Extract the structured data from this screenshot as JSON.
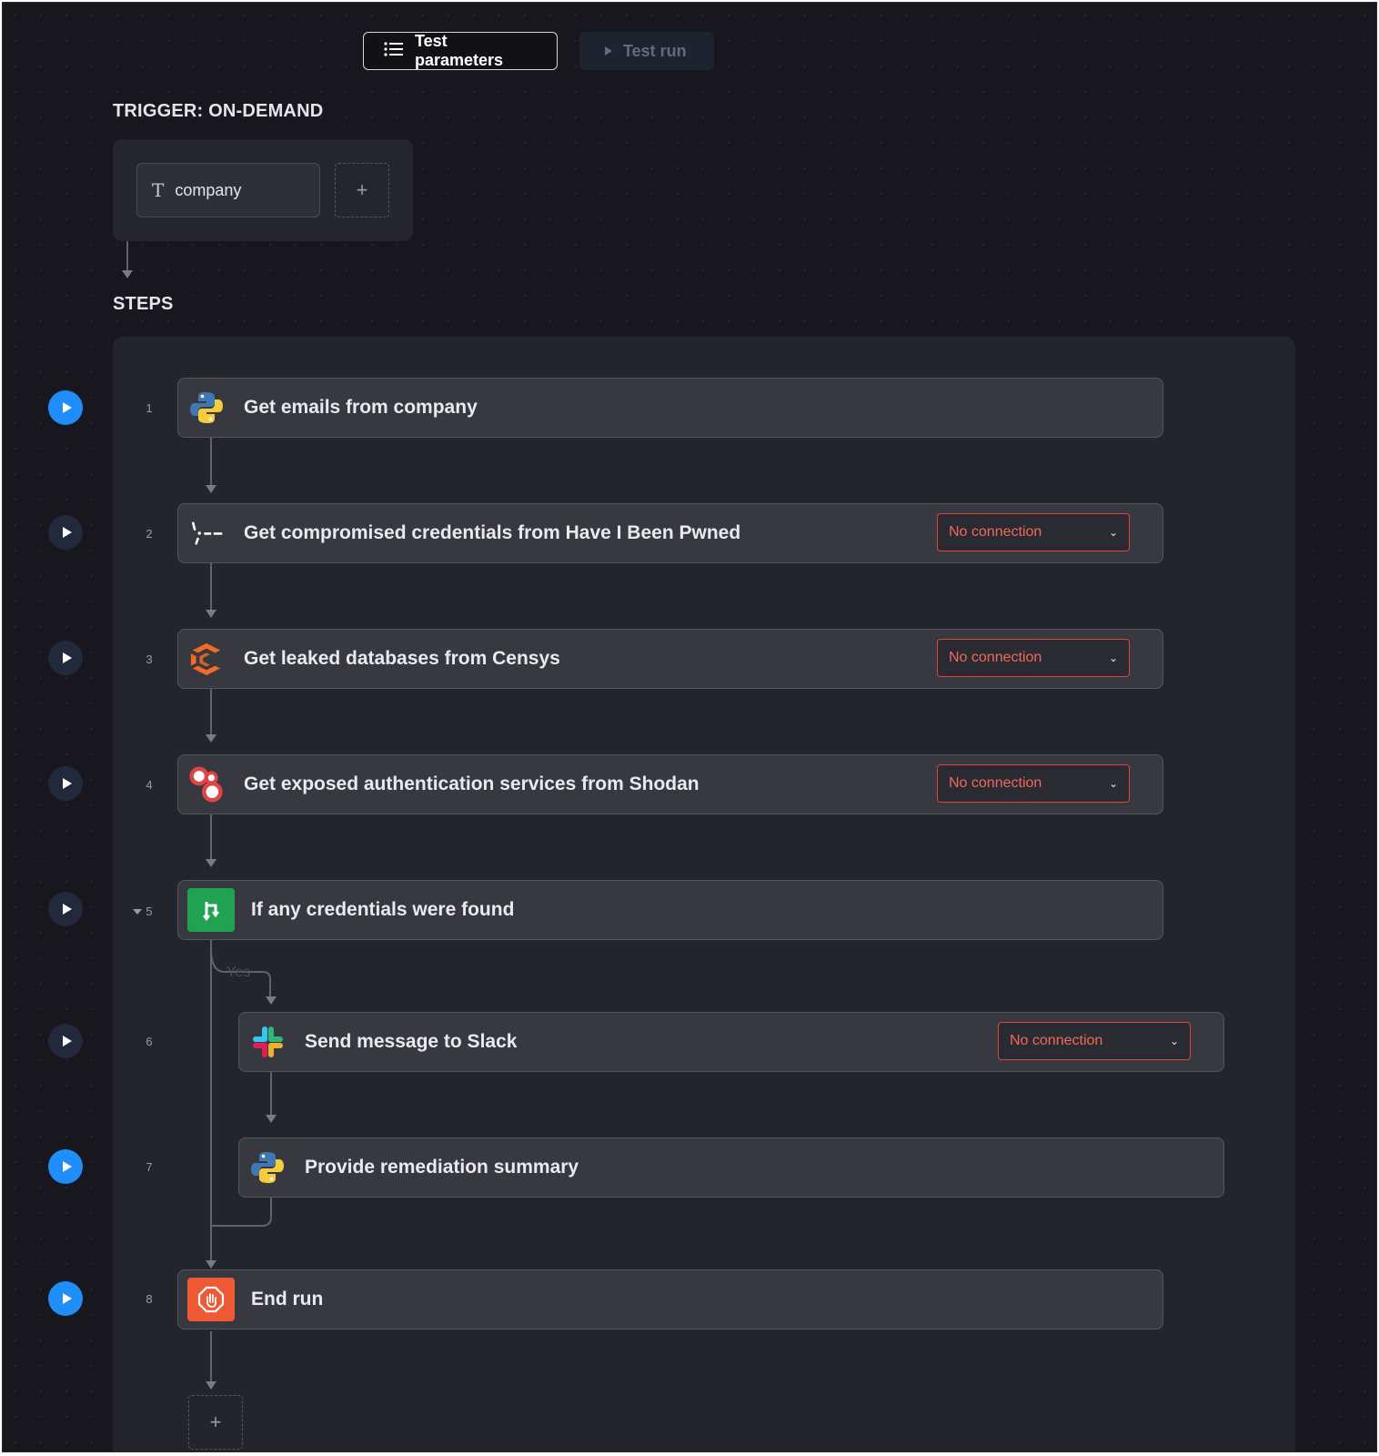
{
  "toolbar": {
    "test_parameters_label": "Test parameters",
    "test_run_label": "Test run"
  },
  "trigger": {
    "heading": "TRIGGER: ON-DEMAND",
    "parameter_name": "company",
    "parameter_type_glyph": "T",
    "add_glyph": "+"
  },
  "steps_heading": "STEPS",
  "steps": [
    {
      "number": "1",
      "title": "Get emails from company",
      "icon": "python-icon",
      "connection": ""
    },
    {
      "number": "2",
      "title": "Get compromised credentials from Have I Been Pwned",
      "icon": "hibp-icon",
      "connection": "No connection"
    },
    {
      "number": "3",
      "title": "Get leaked databases from Censys",
      "icon": "censys-icon",
      "connection": "No connection"
    },
    {
      "number": "4",
      "title": "Get exposed authentication services from Shodan",
      "icon": "shodan-icon",
      "connection": "No connection"
    },
    {
      "number": "5",
      "title": "If any credentials were found",
      "icon": "branch-icon",
      "connection": ""
    },
    {
      "number": "6",
      "title": "Send message to Slack",
      "icon": "slack-icon",
      "connection": "No connection"
    },
    {
      "number": "7",
      "title": "Provide remediation summary",
      "icon": "python-icon",
      "connection": ""
    },
    {
      "number": "8",
      "title": "End run",
      "icon": "stop-hand-icon",
      "connection": ""
    }
  ],
  "branch_label": "Yes",
  "add_step_glyph": "+",
  "colors": {
    "background": "#17171d",
    "card": "#383841",
    "accent_blue": "#1f8efa",
    "error_red": "#e0463a",
    "branch_green": "#21a152",
    "end_orange": "#ee5a35"
  }
}
